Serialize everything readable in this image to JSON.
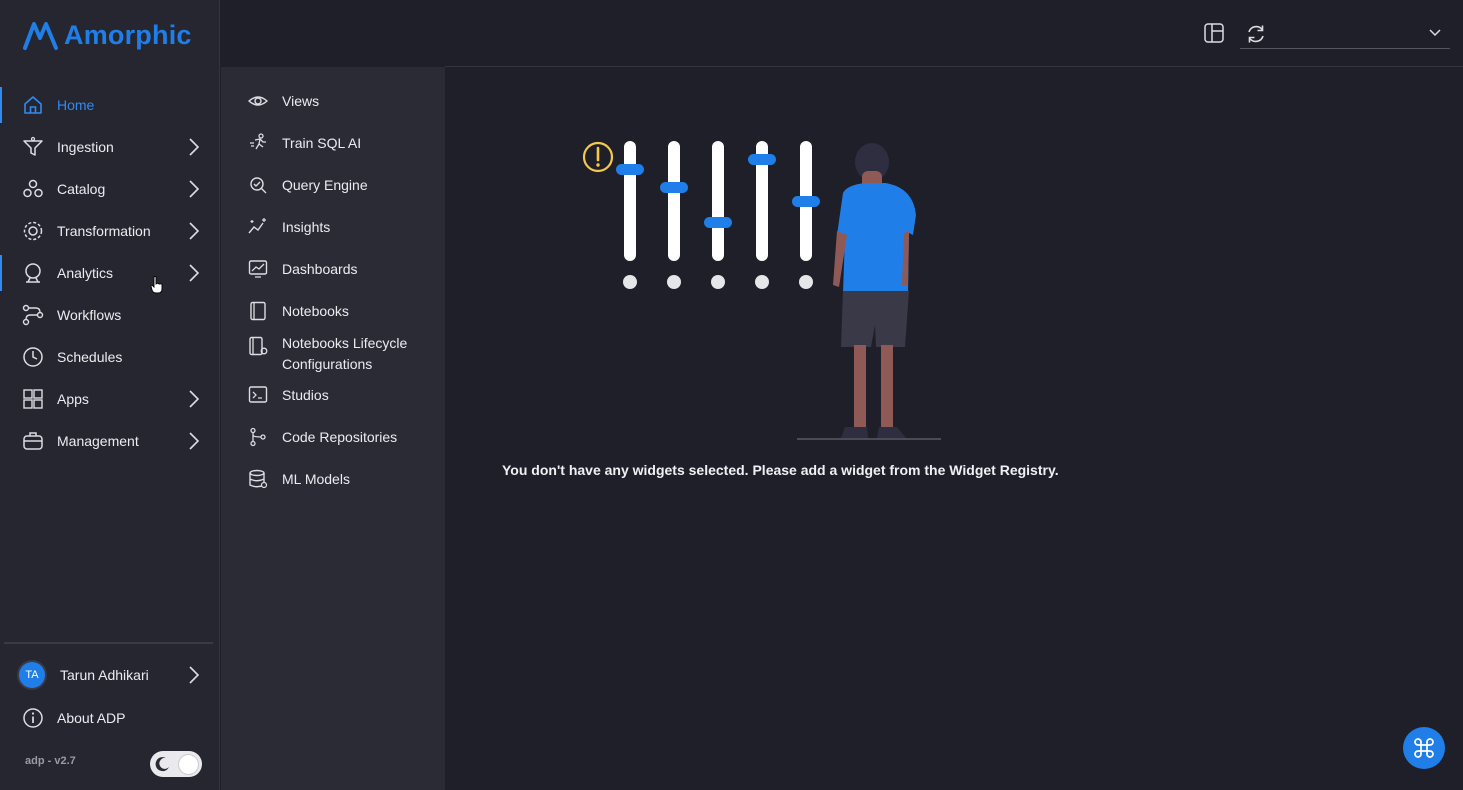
{
  "brand": {
    "name": "Amorphic",
    "color": "#1f7ee8"
  },
  "nav": [
    {
      "label": "Home",
      "icon": "home-icon",
      "active": true,
      "chevron": false
    },
    {
      "label": "Ingestion",
      "icon": "funnel-icon",
      "active": false,
      "chevron": true
    },
    {
      "label": "Catalog",
      "icon": "catalog-icon",
      "active": false,
      "chevron": true
    },
    {
      "label": "Transformation",
      "icon": "gear-icon",
      "active": false,
      "chevron": true
    },
    {
      "label": "Analytics",
      "icon": "analytics-icon",
      "active": false,
      "chevron": true,
      "expanded": true
    },
    {
      "label": "Workflows",
      "icon": "workflow-icon",
      "active": false,
      "chevron": false
    },
    {
      "label": "Schedules",
      "icon": "clock-icon",
      "active": false,
      "chevron": false
    },
    {
      "label": "Apps",
      "icon": "apps-icon",
      "active": false,
      "chevron": true
    },
    {
      "label": "Management",
      "icon": "briefcase-icon",
      "active": false,
      "chevron": true
    }
  ],
  "submenu": [
    {
      "label": "Views",
      "icon": "eye-icon"
    },
    {
      "label": "Train SQL AI",
      "icon": "running-icon"
    },
    {
      "label": "Query Engine",
      "icon": "query-engine-icon"
    },
    {
      "label": "Insights",
      "icon": "sparkle-chart-icon"
    },
    {
      "label": "Dashboards",
      "icon": "dashboard-icon"
    },
    {
      "label": "Notebooks",
      "icon": "notebook-icon"
    },
    {
      "label": "Notebooks Lifecycle Configurations",
      "icon": "notebook-config-icon"
    },
    {
      "label": "Studios",
      "icon": "terminal-icon"
    },
    {
      "label": "Code Repositories",
      "icon": "git-icon"
    },
    {
      "label": "ML Models",
      "icon": "database-icon"
    }
  ],
  "user": {
    "initials": "TA",
    "name": "Tarun Adhikari"
  },
  "about": {
    "label": "About ADP"
  },
  "version": "adp - v2.7",
  "topbar": {
    "select_value": ""
  },
  "empty_state": {
    "message": "You don't have any widgets selected. Please add a widget from the Widget Registry."
  }
}
